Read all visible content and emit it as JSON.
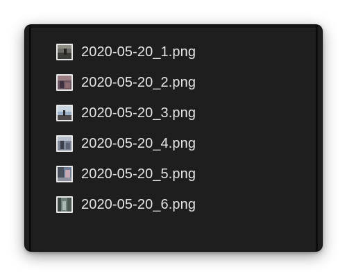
{
  "window": {
    "files": [
      {
        "name": "2020-05-20_1.png",
        "icon": "image-thumbnail-icon"
      },
      {
        "name": "2020-05-20_2.png",
        "icon": "image-thumbnail-icon"
      },
      {
        "name": "2020-05-20_3.png",
        "icon": "image-thumbnail-icon"
      },
      {
        "name": "2020-05-20_4.png",
        "icon": "image-thumbnail-icon"
      },
      {
        "name": "2020-05-20_5.png",
        "icon": "image-thumbnail-icon"
      },
      {
        "name": "2020-05-20_6.png",
        "icon": "image-thumbnail-icon"
      }
    ]
  },
  "colors": {
    "window_background": "#1e1e1e",
    "text": "#e6e6e6",
    "thumbnail_border": "#e9e9e9"
  }
}
